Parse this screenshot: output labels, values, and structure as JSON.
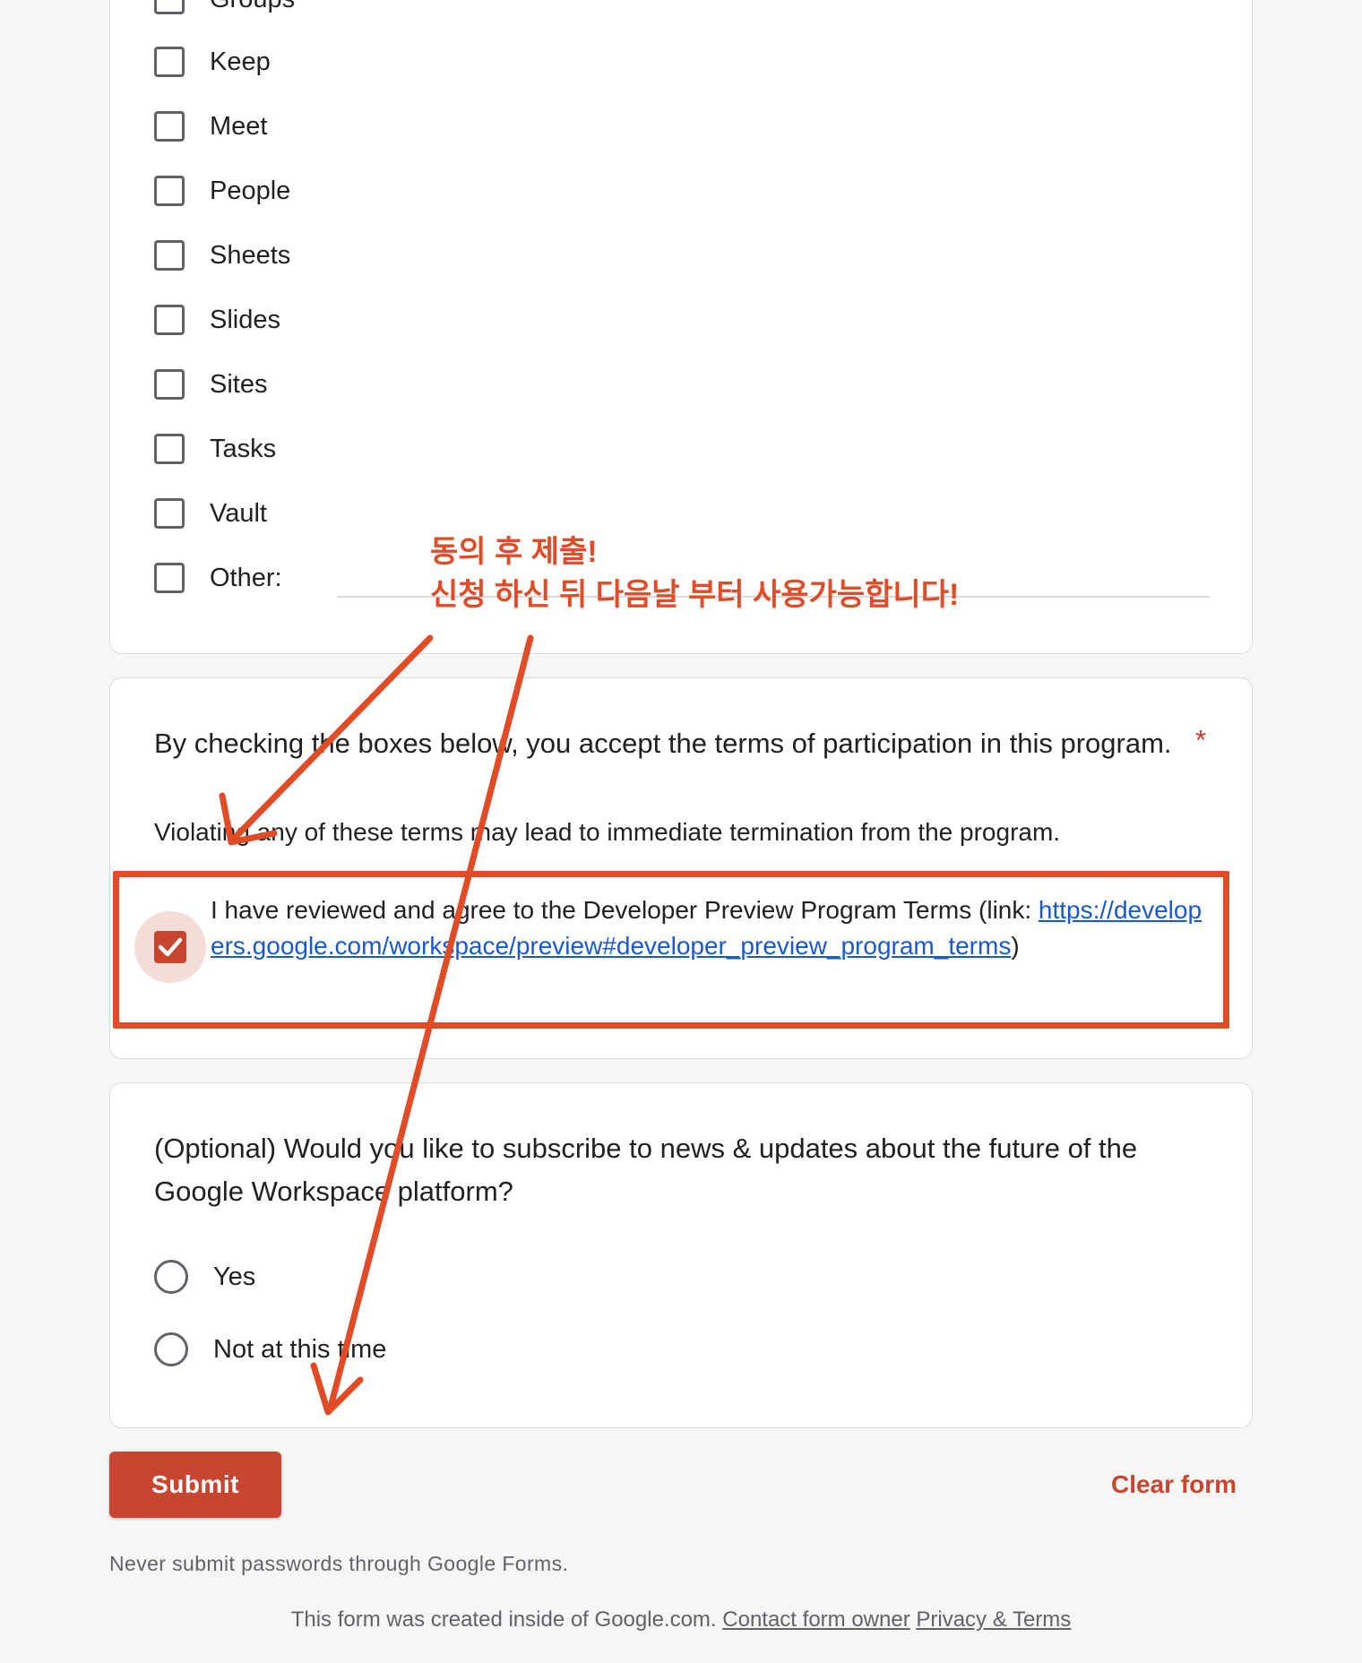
{
  "apps_question": {
    "options": [
      "Groups",
      "Keep",
      "Meet",
      "People",
      "Sheets",
      "Slides",
      "Sites",
      "Tasks",
      "Vault",
      "Other:"
    ]
  },
  "terms_question": {
    "title": "By checking the boxes below, you accept the terms of participation in this program.",
    "required_mark": "*",
    "description": "Violating any of these terms may lead to immediate termination from the program.",
    "agreement_text": "I have reviewed and agree to the Developer Preview Program Terms (link: ",
    "agreement_link": "https://developers.google.com/workspace/preview#developer_preview_program_terms",
    "agreement_suffix": ")",
    "checked": true
  },
  "optional_question": {
    "title": "(Optional) Would you like to subscribe to news & updates about the future of the Google Workspace platform?",
    "options": [
      "Yes",
      "Not at this time"
    ]
  },
  "actions": {
    "submit_label": "Submit",
    "clear_label": "Clear form"
  },
  "footer": {
    "warning": "Never submit passwords through Google Forms.",
    "created_text": "This form was created inside of Google.com.",
    "contact_link": "Contact form owner",
    "privacy_link": "Privacy & Terms"
  },
  "annotation": {
    "text": "동의 후 제출!\n신청 하신 뒤 다음날 부터 사용가능합니다!",
    "color": "#e14b26"
  },
  "colors": {
    "accent": "#c8452f",
    "link": "#1a57d6"
  }
}
